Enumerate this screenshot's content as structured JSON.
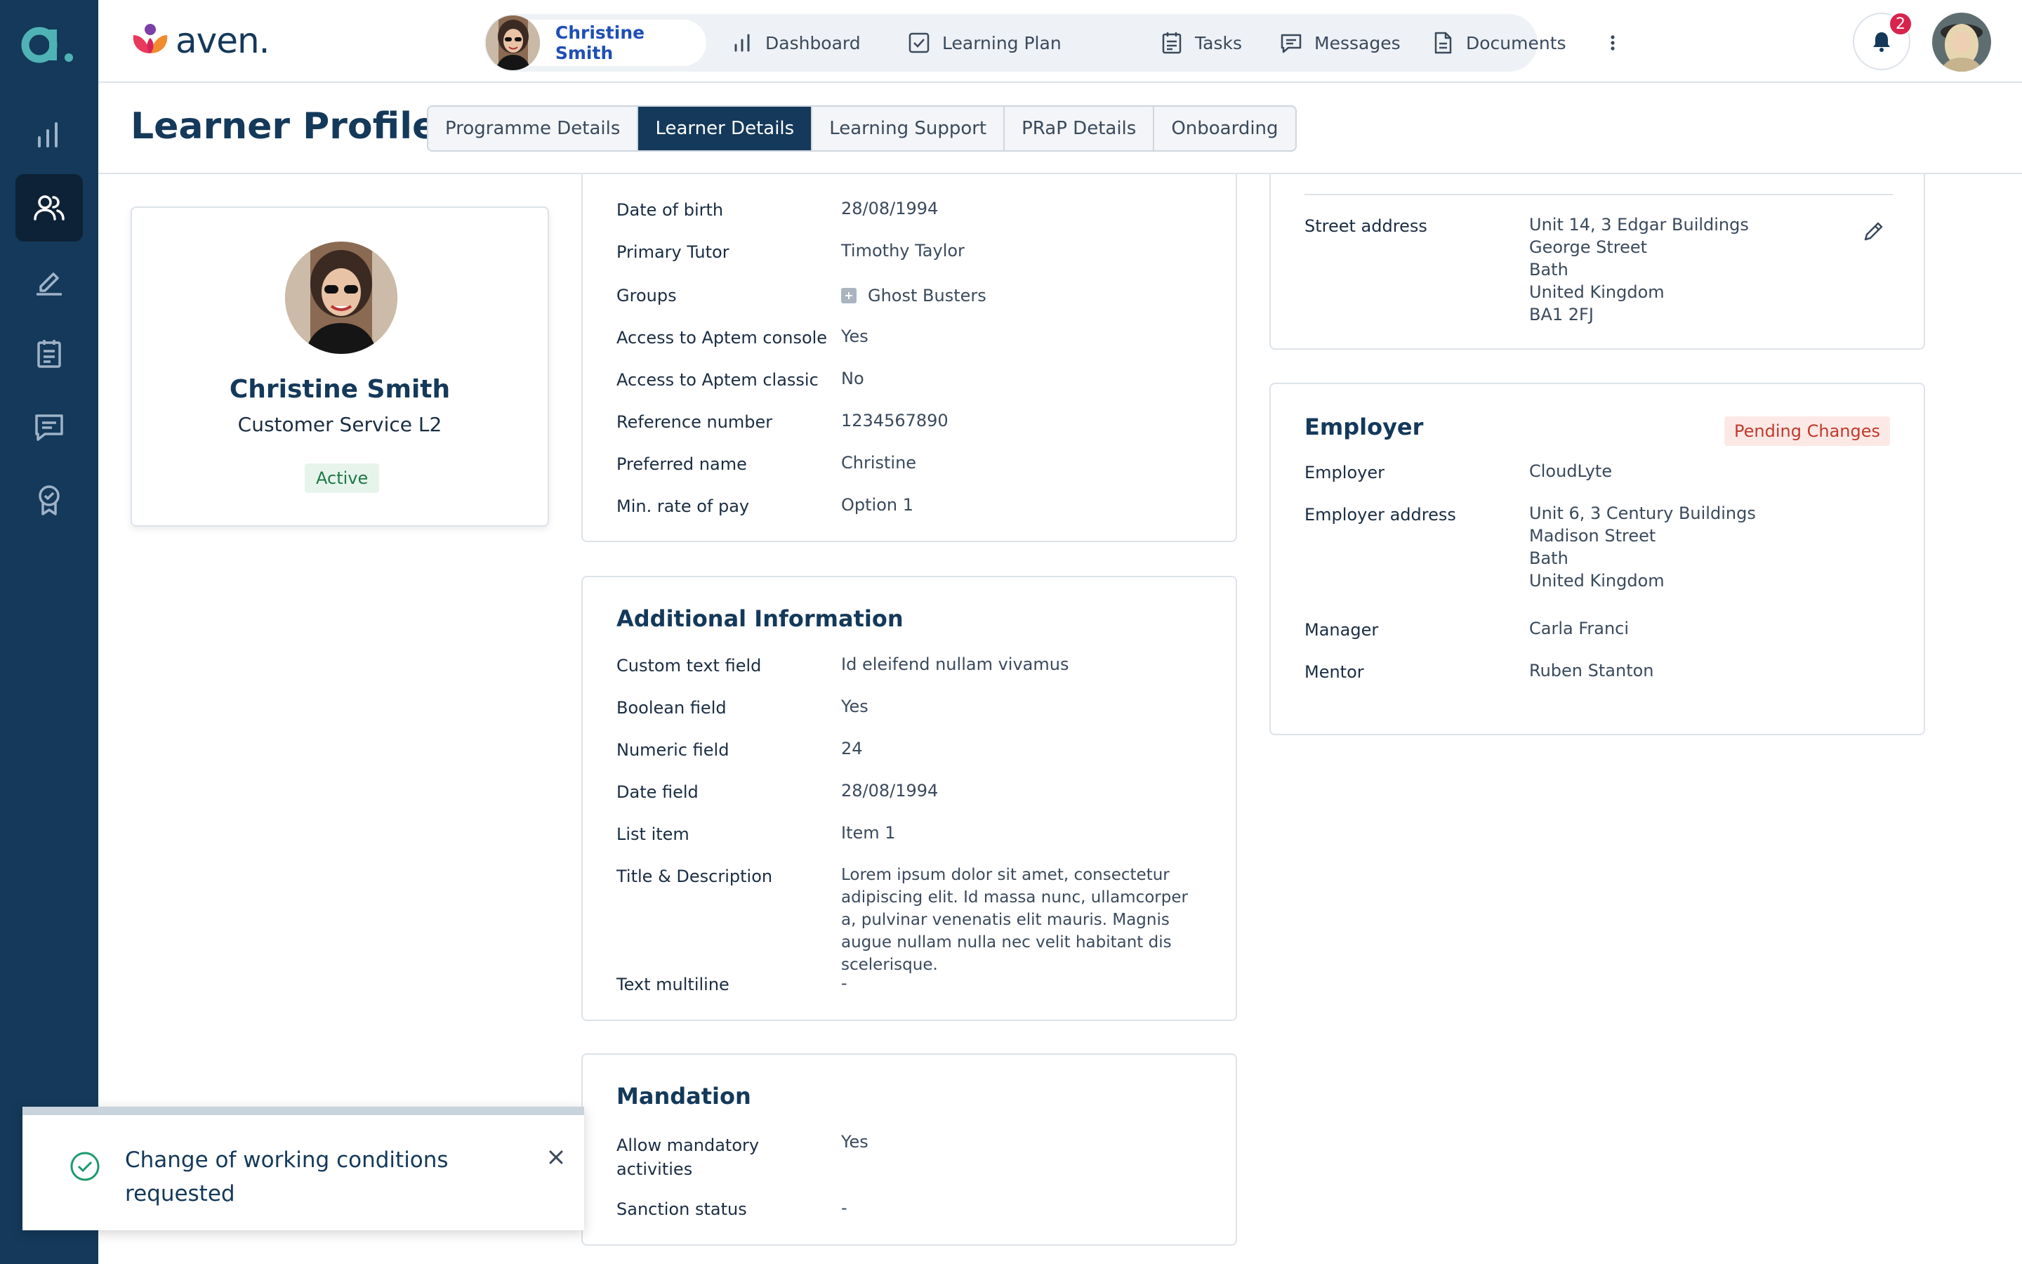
{
  "sidebar": {
    "logo_letter": "a."
  },
  "brand": {
    "name": "aven."
  },
  "nav": {
    "user_name": "Christine Smith",
    "items": [
      {
        "label": "Dashboard",
        "icon": "bar-chart-icon"
      },
      {
        "label": "Learning Plan",
        "icon": "checkbox-icon"
      },
      {
        "label": "Tasks",
        "icon": "clipboard-icon"
      },
      {
        "label": "Messages",
        "icon": "message-icon"
      },
      {
        "label": "Documents",
        "icon": "document-icon"
      }
    ],
    "notification_count": "2"
  },
  "page": {
    "title": "Learner Profile"
  },
  "tabs": [
    {
      "label": "Programme Details",
      "active": false
    },
    {
      "label": "Learner Details",
      "active": true
    },
    {
      "label": "Learning Support",
      "active": false
    },
    {
      "label": "PRaP Details",
      "active": false
    },
    {
      "label": "Onboarding",
      "active": false
    }
  ],
  "profile": {
    "name": "Christine Smith",
    "course": "Customer Service L2",
    "status": "Active"
  },
  "details": [
    {
      "label": "Date of birth",
      "value": "28/08/1994"
    },
    {
      "label": "Primary Tutor",
      "value": "Timothy Taylor"
    },
    {
      "label": "Groups",
      "value": "Ghost Busters"
    },
    {
      "label": "Access to Aptem console",
      "value": "Yes"
    },
    {
      "label": "Access to Aptem classic",
      "value": "No"
    },
    {
      "label": "Reference number",
      "value": "1234567890"
    },
    {
      "label": "Preferred name",
      "value": "Christine"
    },
    {
      "label": "Min. rate of pay",
      "value": "Option 1"
    }
  ],
  "additional": {
    "title": "Additional Information",
    "rows": [
      {
        "label": "Custom text field",
        "value": "Id eleifend nullam vivamus"
      },
      {
        "label": "Boolean field",
        "value": "Yes"
      },
      {
        "label": "Numeric field",
        "value": "24"
      },
      {
        "label": "Date field",
        "value": "28/08/1994"
      },
      {
        "label": "List item",
        "value": "Item 1"
      },
      {
        "label": "Title & Description",
        "value": "Lorem ipsum dolor sit amet, consectetur adipiscing elit. Id massa nunc, ullamcorper a, pulvinar venenatis elit mauris. Magnis augue nullam nulla nec velit habitant dis scelerisque."
      },
      {
        "label": "Text multiline",
        "value": "-"
      }
    ]
  },
  "mandation": {
    "title": "Mandation",
    "rows": [
      {
        "label": "Allow mandatory activities",
        "value": "Yes"
      },
      {
        "label": "Sanction status",
        "value": "-"
      }
    ]
  },
  "address": {
    "label": "Street address",
    "lines": [
      "Unit 14, 3 Edgar Buildings",
      "George Street",
      "Bath",
      "United Kingdom",
      "BA1 2FJ"
    ]
  },
  "employer": {
    "title": "Employer",
    "badge": "Pending Changes",
    "employer_label": "Employer",
    "employer_value": "CloudLyte",
    "address_label": "Employer address",
    "address_lines": [
      "Unit 6, 3 Century Buildings",
      "Madison Street",
      "Bath",
      "United Kingdom"
    ],
    "manager_label": "Manager",
    "manager_value": "Carla Franci",
    "mentor_label": "Mentor",
    "mentor_value": "Ruben Stanton"
  },
  "toast": {
    "message": "Change of working conditions requested"
  },
  "colors": {
    "sidebar": "#14395a",
    "accent": "#1f4fb5",
    "active_tab": "#14395a",
    "pending": "#c0392b",
    "active_badge": "#1d7a45"
  }
}
